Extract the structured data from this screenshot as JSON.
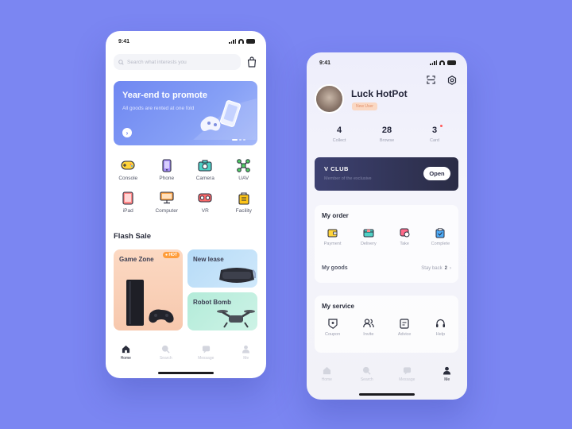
{
  "colors": {
    "background": "#7b86f2",
    "accent": "#6f87f1",
    "club_bg": "#2a2c45",
    "hot": "#ff9d3b"
  },
  "left": {
    "status_time": "9:41",
    "search_placeholder": "Search what interests you",
    "banner": {
      "title": "Year-end to promote",
      "subtitle": "All goods are rented at one fold",
      "arrow": "›"
    },
    "categories": [
      {
        "label": "Console",
        "icon": "gamepad-icon"
      },
      {
        "label": "Phone",
        "icon": "phone-icon"
      },
      {
        "label": "Camera",
        "icon": "camera-icon"
      },
      {
        "label": "UAV",
        "icon": "drone-icon"
      },
      {
        "label": "iPad",
        "icon": "tablet-icon"
      },
      {
        "label": "Computer",
        "icon": "computer-icon"
      },
      {
        "label": "VR",
        "icon": "vr-headset-icon"
      },
      {
        "label": "Facility",
        "icon": "facility-icon"
      }
    ],
    "flash_sale": {
      "title": "Flash Sale",
      "cards": [
        {
          "title": "Game Zone",
          "badge": "HOT"
        },
        {
          "title": "New lease"
        },
        {
          "title": "Robot Bomb"
        }
      ]
    },
    "tabs": [
      {
        "label": "Home",
        "icon": "home-icon"
      },
      {
        "label": "Search",
        "icon": "search-icon"
      },
      {
        "label": "Message",
        "icon": "message-icon"
      },
      {
        "label": "Me",
        "icon": "user-icon"
      }
    ]
  },
  "right": {
    "status_time": "9:41",
    "profile": {
      "name": "Luck HotPot",
      "badge": "New User"
    },
    "stats": [
      {
        "value": "4",
        "label": "Collect"
      },
      {
        "value": "28",
        "label": "Browse"
      },
      {
        "value": "3",
        "label": "Card"
      }
    ],
    "club": {
      "title": "CLUB",
      "subtitle": "Member of the exclusive",
      "button": "Open"
    },
    "order": {
      "title": "My order",
      "items": [
        {
          "label": "Payment",
          "icon": "wallet-icon"
        },
        {
          "label": "Delivery",
          "icon": "delivery-icon"
        },
        {
          "label": "Take",
          "icon": "take-icon"
        },
        {
          "label": "Complete",
          "icon": "complete-icon"
        }
      ],
      "goods_label": "My goods",
      "goods_status": "Stay back",
      "goods_count": "2",
      "goods_arrow": "›"
    },
    "service": {
      "title": "My service",
      "items": [
        {
          "label": "Coupon",
          "icon": "coupon-icon"
        },
        {
          "label": "Invite",
          "icon": "invite-icon"
        },
        {
          "label": "Advice",
          "icon": "advice-icon"
        },
        {
          "label": "Help",
          "icon": "headset-icon"
        }
      ]
    },
    "tabs": [
      {
        "label": "Home",
        "icon": "home-icon"
      },
      {
        "label": "Search",
        "icon": "search-icon"
      },
      {
        "label": "Message",
        "icon": "message-icon"
      },
      {
        "label": "Me",
        "icon": "user-icon"
      }
    ]
  }
}
